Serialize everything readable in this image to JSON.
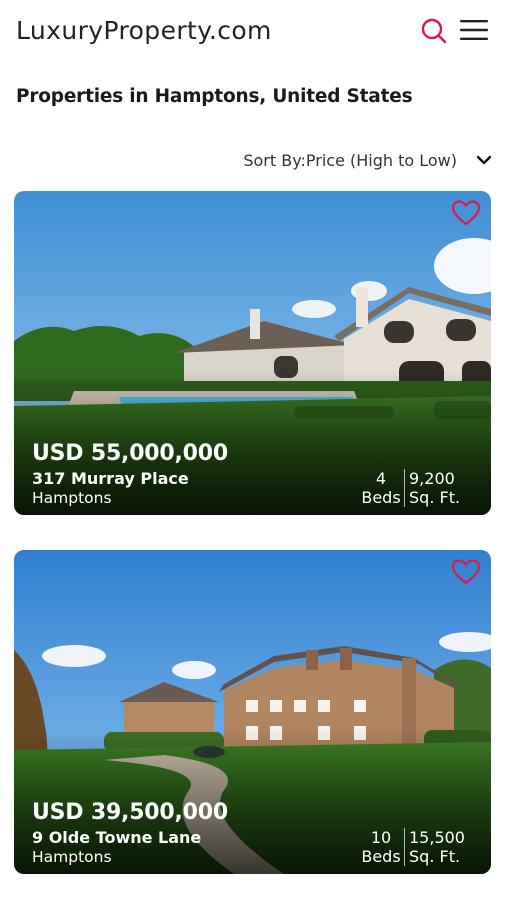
{
  "header": {
    "logo": "LuxuryProperty.com",
    "search_icon": "search-icon",
    "menu_icon": "hamburger-menu-icon",
    "accent_color": "#d81b4a"
  },
  "page": {
    "title": "Properties in Hamptons, United States"
  },
  "sort": {
    "label": "Sort By:Price (High to Low)",
    "icon": "chevron-down-icon"
  },
  "listings": [
    {
      "price": "USD 55,000,000",
      "address": "317 Murray Place",
      "area": "Hamptons",
      "beds_value": "4",
      "beds_label": "Beds",
      "sqft_value": "9,200",
      "sqft_label": "Sq. Ft.",
      "favorite_icon": "heart-outline-icon"
    },
    {
      "price": "USD 39,500,000",
      "address": "9 Olde Towne Lane",
      "area": "Hamptons",
      "beds_value": "10",
      "beds_label": "Beds",
      "sqft_value": "15,500",
      "sqft_label": "Sq. Ft.",
      "favorite_icon": "heart-outline-icon"
    }
  ]
}
